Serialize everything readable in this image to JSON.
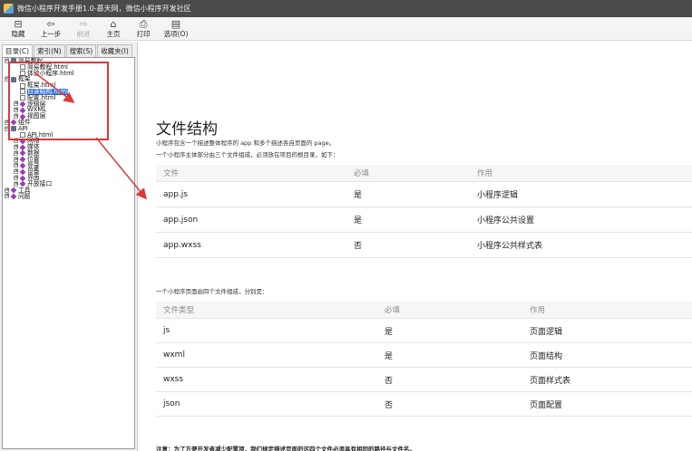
{
  "window": {
    "title": "微信小程序开发手册1.0-慕天网，微信小程序开发社区"
  },
  "toolbar": {
    "items": [
      {
        "label": "隐藏",
        "icon": "hide-icon",
        "glyph": "⊟"
      },
      {
        "label": "上一步",
        "icon": "back-icon",
        "glyph": "⇦"
      },
      {
        "label": "前进",
        "icon": "forward-icon",
        "glyph": "⇨"
      },
      {
        "label": "主页",
        "icon": "home-icon",
        "glyph": "⌂"
      },
      {
        "label": "打印",
        "icon": "print-icon",
        "glyph": "⎙"
      },
      {
        "label": "选项(O)",
        "icon": "options-icon",
        "glyph": "▤"
      }
    ]
  },
  "tabs": {
    "contents": "目录(C)",
    "index": "索引(N)",
    "search": "搜索(S)",
    "favorites": "收藏夹(I)"
  },
  "tree": {
    "items": [
      {
        "label": "简易教程",
        "level": 0,
        "type": "book",
        "expander": "⊟"
      },
      {
        "label": "简易教程.html",
        "level": 1,
        "type": "page"
      },
      {
        "label": "体验小程序.html",
        "level": 1,
        "type": "page"
      },
      {
        "label": "框架",
        "level": 0,
        "type": "book",
        "expander": "⊟"
      },
      {
        "label": "框架.html",
        "level": 1,
        "type": "page"
      },
      {
        "label": "目录结构.html",
        "level": 1,
        "type": "page",
        "selected": true
      },
      {
        "label": "配置.html",
        "level": 1,
        "type": "page"
      },
      {
        "label": "逻辑层",
        "level": 1,
        "type": "dia",
        "expander": "⊞"
      },
      {
        "label": "WXML",
        "level": 1,
        "type": "dia",
        "expander": "⊞"
      },
      {
        "label": "视图层",
        "level": 1,
        "type": "dia",
        "expander": "⊞"
      },
      {
        "label": "组件",
        "level": 0,
        "type": "dia",
        "expander": "⊞"
      },
      {
        "label": "API",
        "level": 0,
        "type": "book",
        "expander": "⊟"
      },
      {
        "label": "API.html",
        "level": 1,
        "type": "page"
      },
      {
        "label": "网络",
        "level": 1,
        "type": "dia",
        "expander": "⊞"
      },
      {
        "label": "媒体",
        "level": 1,
        "type": "dia",
        "expander": "⊞"
      },
      {
        "label": "数据",
        "level": 1,
        "type": "dia",
        "expander": "⊞"
      },
      {
        "label": "位置",
        "level": 1,
        "type": "dia",
        "expander": "⊞"
      },
      {
        "label": "登录",
        "level": 1,
        "type": "dia",
        "expander": "⊞"
      },
      {
        "label": "设备",
        "level": 1,
        "type": "dia",
        "expander": "⊞"
      },
      {
        "label": "界面",
        "level": 1,
        "type": "dia",
        "expander": "⊞"
      },
      {
        "label": "开放接口",
        "level": 1,
        "type": "dia",
        "expander": "⊞"
      },
      {
        "label": "工具",
        "level": 0,
        "type": "dia",
        "expander": "⊞"
      },
      {
        "label": "问题",
        "level": 0,
        "type": "dia",
        "expander": "⊞"
      }
    ]
  },
  "content": {
    "title": "文件结构",
    "desc1": "小程序包含一个描述整体程序的 app 和多个描述各自页面的 page。",
    "desc2": "一个小程序主体部分由三个文件组成，必须放在项目的根目录，如下：",
    "table1": {
      "headers": [
        "文件",
        "必填",
        "作用"
      ],
      "rows": [
        [
          "app.js",
          "是",
          "小程序逻辑"
        ],
        [
          "app.json",
          "是",
          "小程序公共设置"
        ],
        [
          "app.wxss",
          "否",
          "小程序公共样式表"
        ]
      ]
    },
    "desc3": "一个小程序页面由四个文件组成，分别是：",
    "table2": {
      "headers": [
        "文件类型",
        "必填",
        "作用"
      ],
      "rows": [
        [
          "js",
          "是",
          "页面逻辑"
        ],
        [
          "wxml",
          "是",
          "页面结构"
        ],
        [
          "wxss",
          "否",
          "页面样式表"
        ],
        [
          "json",
          "否",
          "页面配置"
        ]
      ]
    },
    "note": "注意：为了方便开发者减少配置项，我们规定描述页面的这四个文件必须具有相同的路径与文件名。"
  },
  "colors": {
    "titlebar": "#4a4a4a",
    "annotation": "#d93a3a",
    "selection": "#3874d8"
  }
}
